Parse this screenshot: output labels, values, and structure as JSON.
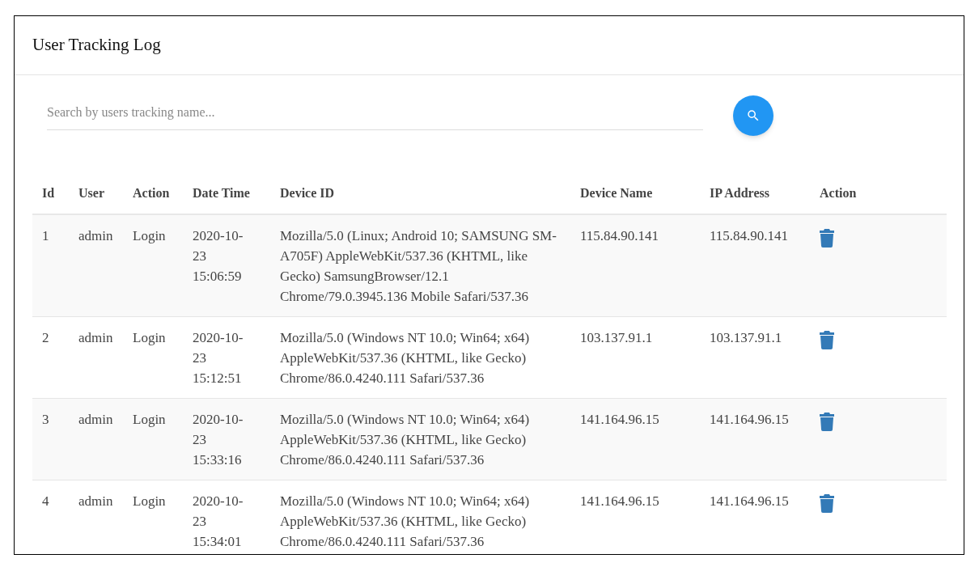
{
  "card": {
    "title": "User Tracking Log"
  },
  "search": {
    "placeholder": "Search by users tracking name..."
  },
  "table": {
    "columns": [
      "Id",
      "User",
      "Action",
      "Date Time",
      "Device ID",
      "Device Name",
      "IP Address",
      "Action"
    ],
    "rows": [
      {
        "id": "1",
        "user": "admin",
        "action": "Login",
        "date_time": "2020-10-23 15:06:59",
        "device_id": "Mozilla/5.0 (Linux; Android 10; SAMSUNG SM-A705F) AppleWebKit/537.36 (KHTML, like Gecko) SamsungBrowser/12.1 Chrome/79.0.3945.136 Mobile Safari/537.36",
        "device_name": "115.84.90.141",
        "ip_address": "115.84.90.141"
      },
      {
        "id": "2",
        "user": "admin",
        "action": "Login",
        "date_time": "2020-10-23 15:12:51",
        "device_id": "Mozilla/5.0 (Windows NT 10.0; Win64; x64) AppleWebKit/537.36 (KHTML, like Gecko) Chrome/86.0.4240.111 Safari/537.36",
        "device_name": "103.137.91.1",
        "ip_address": "103.137.91.1"
      },
      {
        "id": "3",
        "user": "admin",
        "action": "Login",
        "date_time": "2020-10-23 15:33:16",
        "device_id": "Mozilla/5.0 (Windows NT 10.0; Win64; x64) AppleWebKit/537.36 (KHTML, like Gecko) Chrome/86.0.4240.111 Safari/537.36",
        "device_name": "141.164.96.15",
        "ip_address": "141.164.96.15"
      },
      {
        "id": "4",
        "user": "admin",
        "action": "Login",
        "date_time": "2020-10-23 15:34:01",
        "device_id": "Mozilla/5.0 (Windows NT 10.0; Win64; x64) AppleWebKit/537.36 (KHTML, like Gecko) Chrome/86.0.4240.111 Safari/537.36",
        "device_name": "141.164.96.15",
        "ip_address": "141.164.96.15"
      }
    ]
  }
}
